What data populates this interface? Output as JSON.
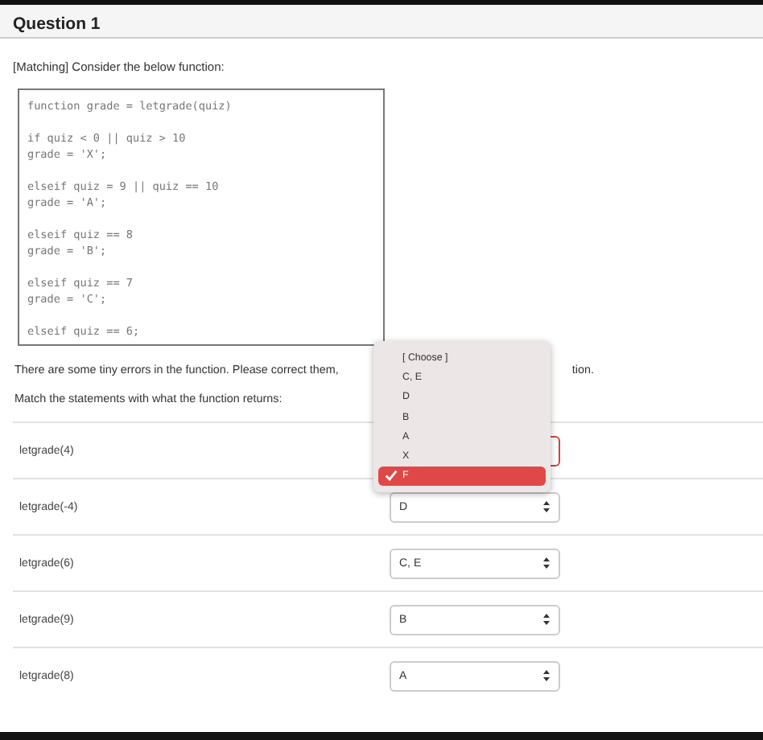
{
  "question": {
    "title": "Question 1",
    "prompt": "[Matching] Consider the below function:"
  },
  "code_blocks": [
    [
      "function grade = letgrade(quiz)"
    ],
    [
      "if quiz < 0 || quiz > 10",
      "grade = 'X';"
    ],
    [
      "elseif quiz = 9 || quiz == 10",
      "grade = 'A';"
    ],
    [
      "elseif quiz == 8",
      "grade = 'B';"
    ],
    [
      "elseif quiz == 7",
      "grade = 'C';"
    ],
    [
      "elseif quiz == 6;"
    ]
  ],
  "instruction_left": "There are some tiny errors in the function. Please correct them,",
  "instruction_right": "tion.",
  "match_prompt": "Match the statements with what the function returns:",
  "rows": [
    {
      "statement": "letgrade(4)"
    },
    {
      "statement": "letgrade(-4)",
      "value": "D"
    },
    {
      "statement": "letgrade(6)",
      "value": "C, E"
    },
    {
      "statement": "letgrade(9)",
      "value": "B"
    },
    {
      "statement": "letgrade(8)",
      "value": "A"
    }
  ],
  "open_menu": {
    "options": [
      {
        "label": "[ Choose ]",
        "selected": false
      },
      {
        "label": "C, E",
        "selected": false
      },
      {
        "label": "D",
        "selected": false
      },
      {
        "label": "B",
        "selected": false
      },
      {
        "label": "A",
        "selected": false
      },
      {
        "label": "X",
        "selected": false
      },
      {
        "label": "F",
        "selected": true
      }
    ]
  }
}
